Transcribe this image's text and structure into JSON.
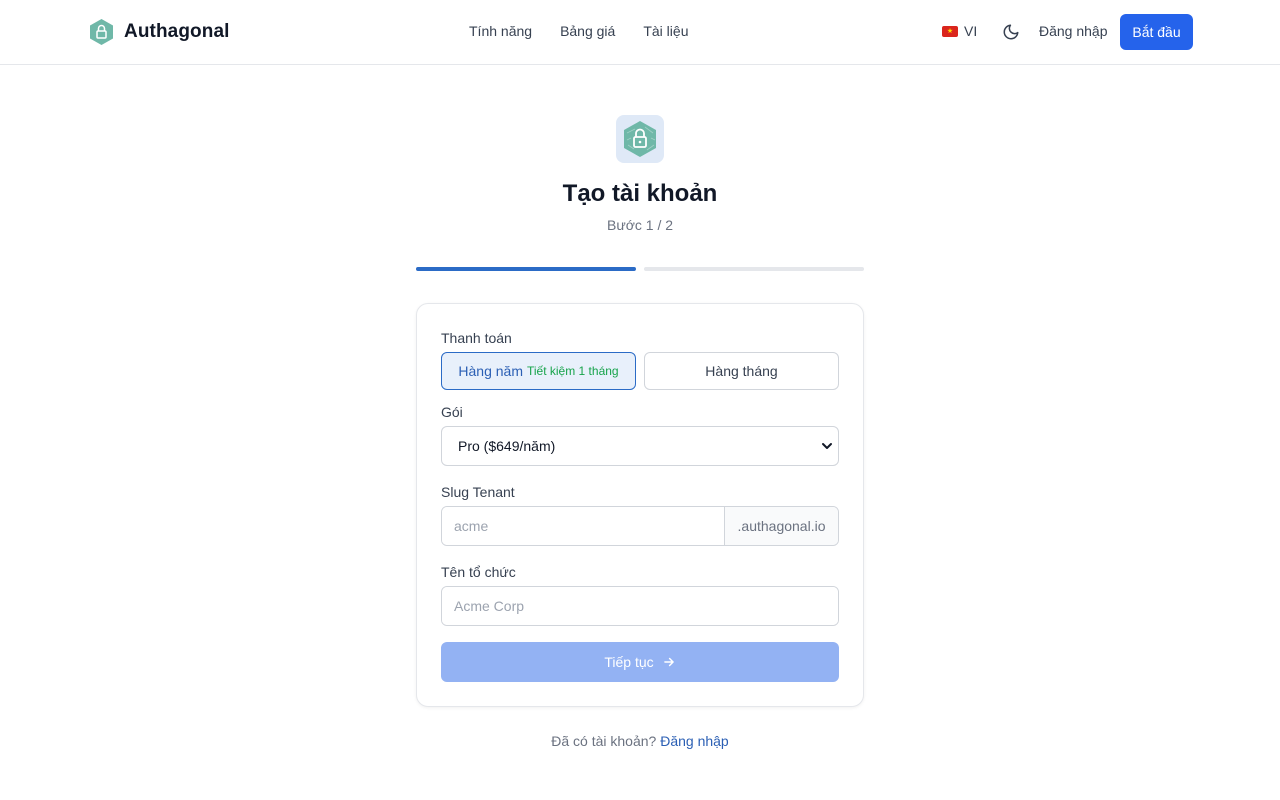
{
  "header": {
    "brand_name": "Authagonal",
    "nav": [
      "Tính năng",
      "Bảng giá",
      "Tài liệu"
    ],
    "language": "VI",
    "signin_label": "Đăng nhập",
    "start_label": "Bắt đầu"
  },
  "main": {
    "title": "Tạo tài khoản",
    "step": "Bước 1 / 2",
    "progress": {
      "current_step": 1,
      "total_steps": 2
    }
  },
  "form": {
    "billing_label": "Thanh toán",
    "billing_yearly": "Hàng năm",
    "billing_yearly_badge": "Tiết kiệm 1 tháng",
    "billing_monthly": "Hàng tháng",
    "plan_label": "Gói",
    "plan_value": "Pro ($649/năm)",
    "slug_label": "Slug Tenant",
    "slug_placeholder": "acme",
    "slug_suffix": ".authagonal.io",
    "org_label": "Tên tổ chức",
    "org_placeholder": "Acme Corp",
    "continue_label": "Tiếp tục"
  },
  "footer": {
    "prompt": "Đã có tài khoản?",
    "signin_link": "Đăng nhập"
  },
  "colors": {
    "primary": "#2563eb",
    "accent": "#2b6bc6",
    "success": "#16a34a",
    "logo": "#6fb8a8"
  }
}
